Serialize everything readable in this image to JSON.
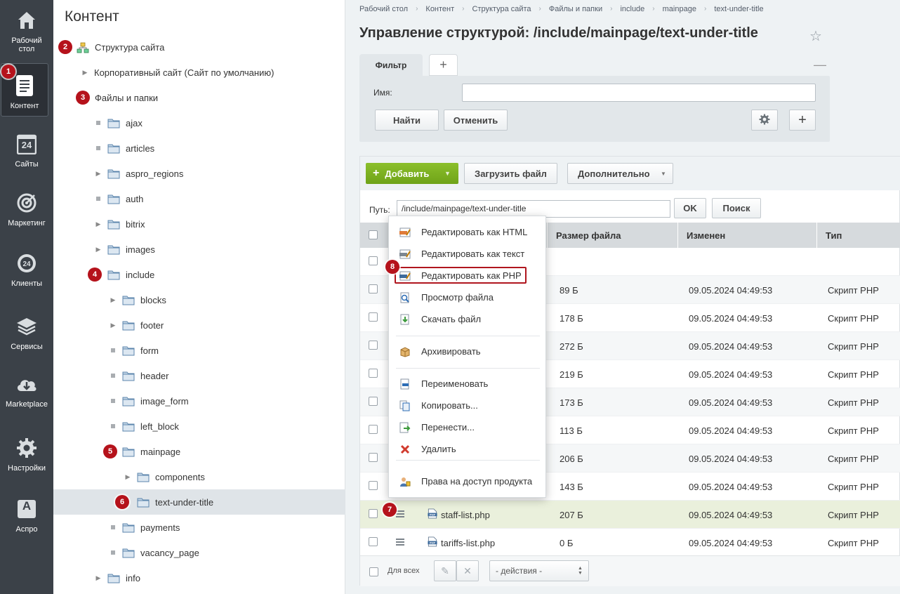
{
  "colors": {
    "sidebar_bg": "#3b4148",
    "badge": "#b5121b",
    "green_btn": "#7ab01e",
    "highlight": "#b0161e"
  },
  "sidebar": {
    "items": [
      {
        "label": "Рабочий стол",
        "icon": "home-icon"
      },
      {
        "label": "Контент",
        "icon": "document-icon",
        "active": true
      },
      {
        "label": "Сайты",
        "icon": "calendar-24-icon"
      },
      {
        "label": "Маркетинг",
        "icon": "target-icon"
      },
      {
        "label": "Клиенты",
        "icon": "crm-24-icon"
      },
      {
        "label": "Сервисы",
        "icon": "layers-icon"
      },
      {
        "label": "Marketplace",
        "icon": "cloud-download-icon"
      },
      {
        "label": "Настройки",
        "icon": "gear-icon"
      },
      {
        "label": "Аспро",
        "icon": "aspro-a-icon"
      }
    ],
    "calendar_number": "24",
    "aspro_letter": "A"
  },
  "badges": [
    "1",
    "2",
    "3",
    "4",
    "5",
    "6",
    "7",
    "8"
  ],
  "tree": {
    "title": "Контент",
    "nodes": [
      "Структура сайта",
      "Корпоративный сайт (Сайт по умолчанию)",
      "Файлы и папки",
      "ajax",
      "articles",
      "aspro_regions",
      "auth",
      "bitrix",
      "images",
      "include",
      "blocks",
      "footer",
      "form",
      "header",
      "image_form",
      "left_block",
      "mainpage",
      "components",
      "text-under-title",
      "payments",
      "vacancy_page",
      "info"
    ]
  },
  "breadcrumbs": [
    "Рабочий стол",
    "Контент",
    "Структура сайта",
    "Файлы и папки",
    "include",
    "mainpage",
    "text-under-title"
  ],
  "page_title": "Управление структурой: /include/mainpage/text-under-title",
  "filter": {
    "tab_label": "Фильтр",
    "add_tab": "+",
    "collapse": "—",
    "name_label": "Имя:",
    "name_value": "",
    "find_label": "Найти",
    "cancel_label": "Отменить",
    "add_label": "+"
  },
  "toolbar": {
    "add_label": "Добавить",
    "upload_label": "Загрузить файл",
    "more_label": "Дополнительно"
  },
  "path": {
    "label": "Путь:",
    "value": "/include/mainpage/text-under-title",
    "ok_label": "OK",
    "search_label": "Поиск"
  },
  "grid": {
    "columns": [
      "Размер файла",
      "Изменен",
      "Тип"
    ],
    "rows": [
      {
        "name": "",
        "size": "",
        "date": "",
        "type": ""
      },
      {
        "name": "",
        "size": "89 Б",
        "date": "09.05.2024 04:49:53",
        "type": "Скрипт PHP"
      },
      {
        "name": "",
        "size": "178 Б",
        "date": "09.05.2024 04:49:53",
        "type": "Скрипт PHP"
      },
      {
        "name": "",
        "size": "272 Б",
        "date": "09.05.2024 04:49:53",
        "type": "Скрипт PHP"
      },
      {
        "name": "",
        "size": "219 Б",
        "date": "09.05.2024 04:49:53",
        "type": "Скрипт PHP"
      },
      {
        "name": "",
        "size": "173 Б",
        "date": "09.05.2024 04:49:53",
        "type": "Скрипт PHP"
      },
      {
        "name": "",
        "size": "113 Б",
        "date": "09.05.2024 04:49:53",
        "type": "Скрипт PHP"
      },
      {
        "name": "",
        "size": "206 Б",
        "date": "09.05.2024 04:49:53",
        "type": "Скрипт PHP"
      },
      {
        "name": "",
        "size": "143 Б",
        "date": "09.05.2024 04:49:53",
        "type": "Скрипт PHP"
      },
      {
        "name": "staff-list.php",
        "size": "207 Б",
        "date": "09.05.2024 04:49:53",
        "type": "Скрипт PHP"
      },
      {
        "name": "tariffs-list.php",
        "size": "0 Б",
        "date": "09.05.2024 04:49:53",
        "type": "Скрипт PHP"
      }
    ],
    "footer_all_label": "Для всех",
    "actions_select": "- действия -"
  },
  "context_menu": {
    "items": [
      {
        "label": "Редактировать как HTML",
        "icon": "edit-html-icon"
      },
      {
        "label": "Редактировать как текст",
        "icon": "edit-text-icon"
      },
      {
        "label": "Редактировать как PHP",
        "icon": "edit-php-icon"
      },
      {
        "label": "Просмотр файла",
        "icon": "view-file-icon"
      },
      {
        "label": "Скачать файл",
        "icon": "download-file-icon"
      },
      {
        "label": "Архивировать",
        "icon": "archive-icon"
      },
      {
        "label": "Переименовать",
        "icon": "rename-icon"
      },
      {
        "label": "Копировать...",
        "icon": "copy-icon"
      },
      {
        "label": "Перенести...",
        "icon": "move-icon"
      },
      {
        "label": "Удалить",
        "icon": "delete-icon"
      },
      {
        "label": "Права на доступ продукта",
        "icon": "access-rights-icon"
      }
    ]
  }
}
